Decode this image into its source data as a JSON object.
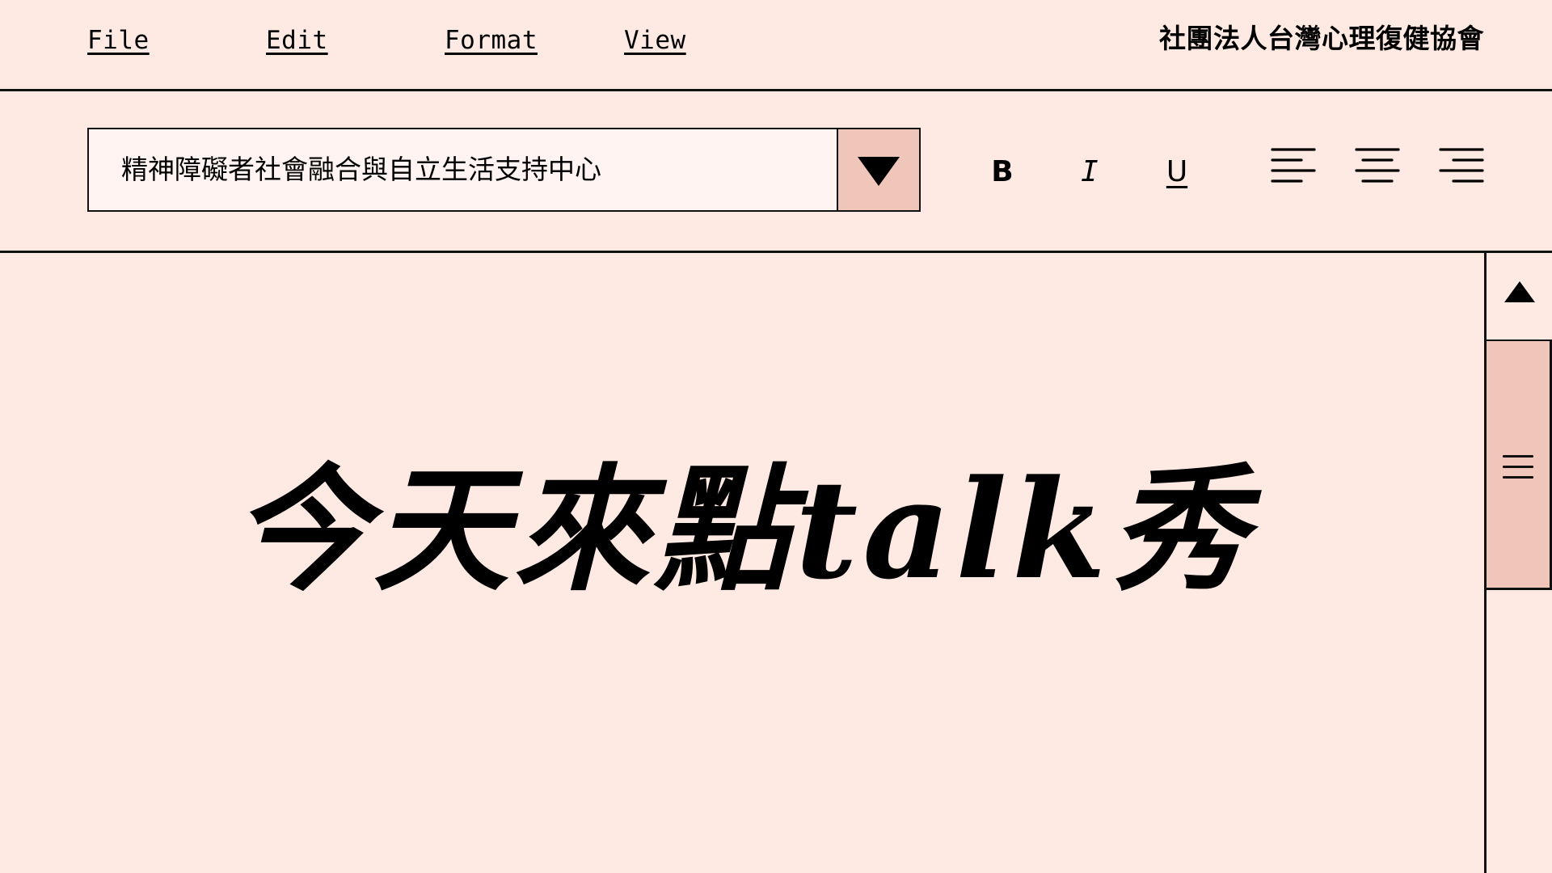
{
  "menu": {
    "items": [
      {
        "label": "File"
      },
      {
        "label": "Edit"
      },
      {
        "label": "Format"
      },
      {
        "label": "View"
      }
    ],
    "org_title": "社團法人台灣心理復健協會"
  },
  "toolbar": {
    "dropdown": {
      "selected_value": "精神障礙者社會融合與自立生活支持中心",
      "icon": "chevron-down-icon"
    },
    "bold_label": "B",
    "italic_label": "I",
    "underline_label": "U",
    "align_buttons": [
      {
        "name": "align-left",
        "icon": "align-left-icon"
      },
      {
        "name": "align-center",
        "icon": "align-center-icon"
      },
      {
        "name": "align-right",
        "icon": "align-right-icon"
      }
    ]
  },
  "document": {
    "headline": "今天來點talk秀"
  },
  "scrollbar": {
    "up_icon": "arrow-up-icon",
    "thumb_icon": "grip-icon",
    "scroll_position": 0.15
  },
  "colors": {
    "background": "#FFEAE3",
    "accent": "#F0C5BA",
    "input_background": "#FFF4F1",
    "ink": "#111111"
  }
}
